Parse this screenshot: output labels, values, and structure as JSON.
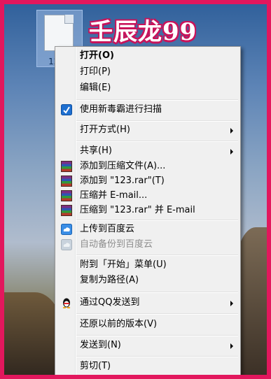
{
  "desktop": {
    "file_label": "123.r",
    "watermark": "壬辰龙99"
  },
  "menu": {
    "items": [
      {
        "label": "打开(O)",
        "bold": true
      },
      {
        "label": "打印(P)"
      },
      {
        "label": "编辑(E)"
      },
      {
        "label": "使用新毒霸进行扫描",
        "icon": "duba-icon"
      },
      {
        "label": "打开方式(H)",
        "submenu": true
      },
      {
        "label": "共享(H)",
        "submenu": true
      },
      {
        "label": "添加到压缩文件(A)...",
        "icon": "winrar-icon"
      },
      {
        "label": "添加到 \"123.rar\"(T)",
        "icon": "winrar-icon"
      },
      {
        "label": "压缩并 E-mail...",
        "icon": "winrar-icon"
      },
      {
        "label": "压缩到 \"123.rar\" 并 E-mail",
        "icon": "winrar-icon"
      },
      {
        "label": "上传到百度云",
        "icon": "baidu-cloud-icon"
      },
      {
        "label": "自动备份到百度云",
        "icon": "baidu-cloud-icon",
        "disabled": true
      },
      {
        "label": "附到「开始」菜单(U)"
      },
      {
        "label": "复制为路径(A)"
      },
      {
        "label": "通过QQ发送到",
        "icon": "qq-penguin-icon",
        "submenu": true
      },
      {
        "label": "还原以前的版本(V)"
      },
      {
        "label": "发送到(N)",
        "submenu": true
      },
      {
        "label": "剪切(T)"
      }
    ]
  },
  "colors": {
    "frame": "#e2175d",
    "menu_bg": "#f0f0f0"
  }
}
